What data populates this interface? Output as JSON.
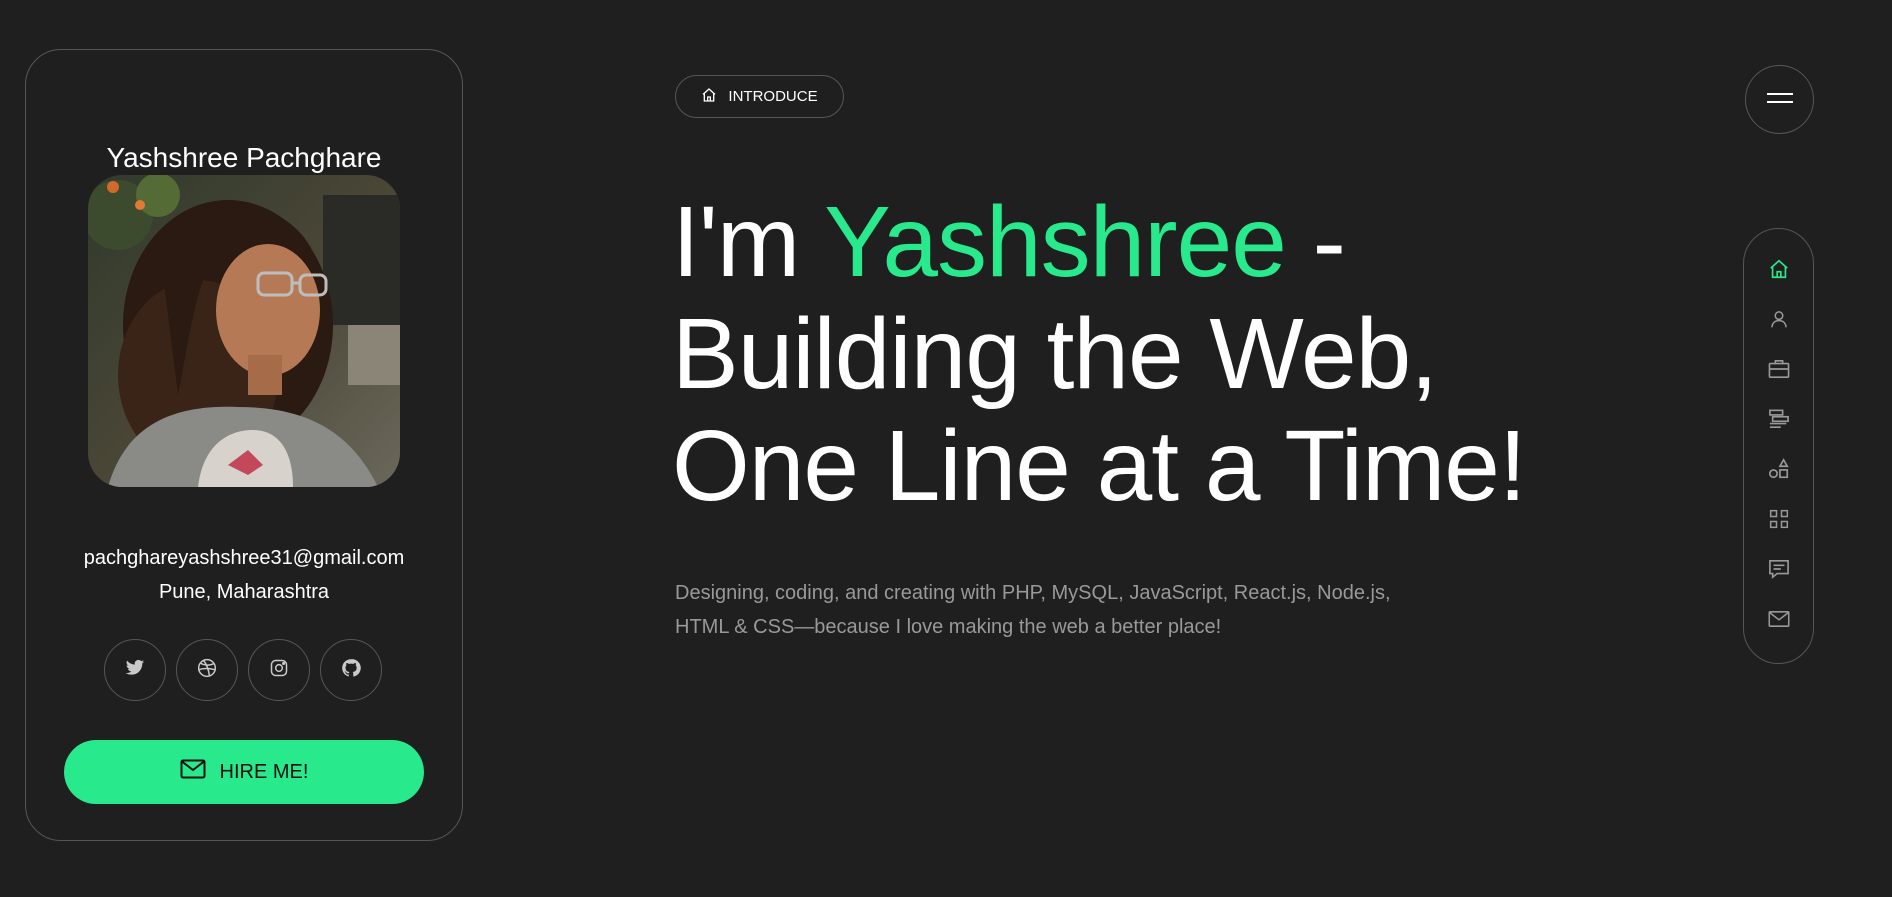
{
  "card": {
    "name": "Yashshree Pachghare",
    "email": "pachghareyashshree31@gmail.com",
    "location": "Pune, Maharashtra",
    "socials": [
      {
        "icon": "twitter-icon"
      },
      {
        "icon": "dribbble-icon"
      },
      {
        "icon": "instagram-icon"
      },
      {
        "icon": "github-icon"
      }
    ],
    "hire_label": "HIRE ME!"
  },
  "intro": {
    "label": "INTRODUCE",
    "icon": "home-icon"
  },
  "hero": {
    "line1_prefix": "I'm ",
    "line1_accent": "Yashshree",
    "line1_suffix": " -",
    "line2": "Building the Web,",
    "line3": "One Line at a Time!",
    "description_line1": "Designing, coding, and creating with PHP, MySQL, JavaScript, React.js, Node.js,",
    "description_line2": "HTML & CSS—because I love making the web a better place!"
  },
  "nav": {
    "items": [
      {
        "icon": "home-icon",
        "active": true
      },
      {
        "icon": "user-icon",
        "active": false
      },
      {
        "icon": "briefcase-icon",
        "active": false
      },
      {
        "icon": "resume-icon",
        "active": false
      },
      {
        "icon": "services-icon",
        "active": false
      },
      {
        "icon": "grid-icon",
        "active": false
      },
      {
        "icon": "comment-icon",
        "active": false
      },
      {
        "icon": "envelope-icon",
        "active": false
      }
    ]
  },
  "colors": {
    "accent": "#28e98c",
    "background": "#1f1f1f",
    "border": "#565656",
    "muted_text": "#999999"
  }
}
